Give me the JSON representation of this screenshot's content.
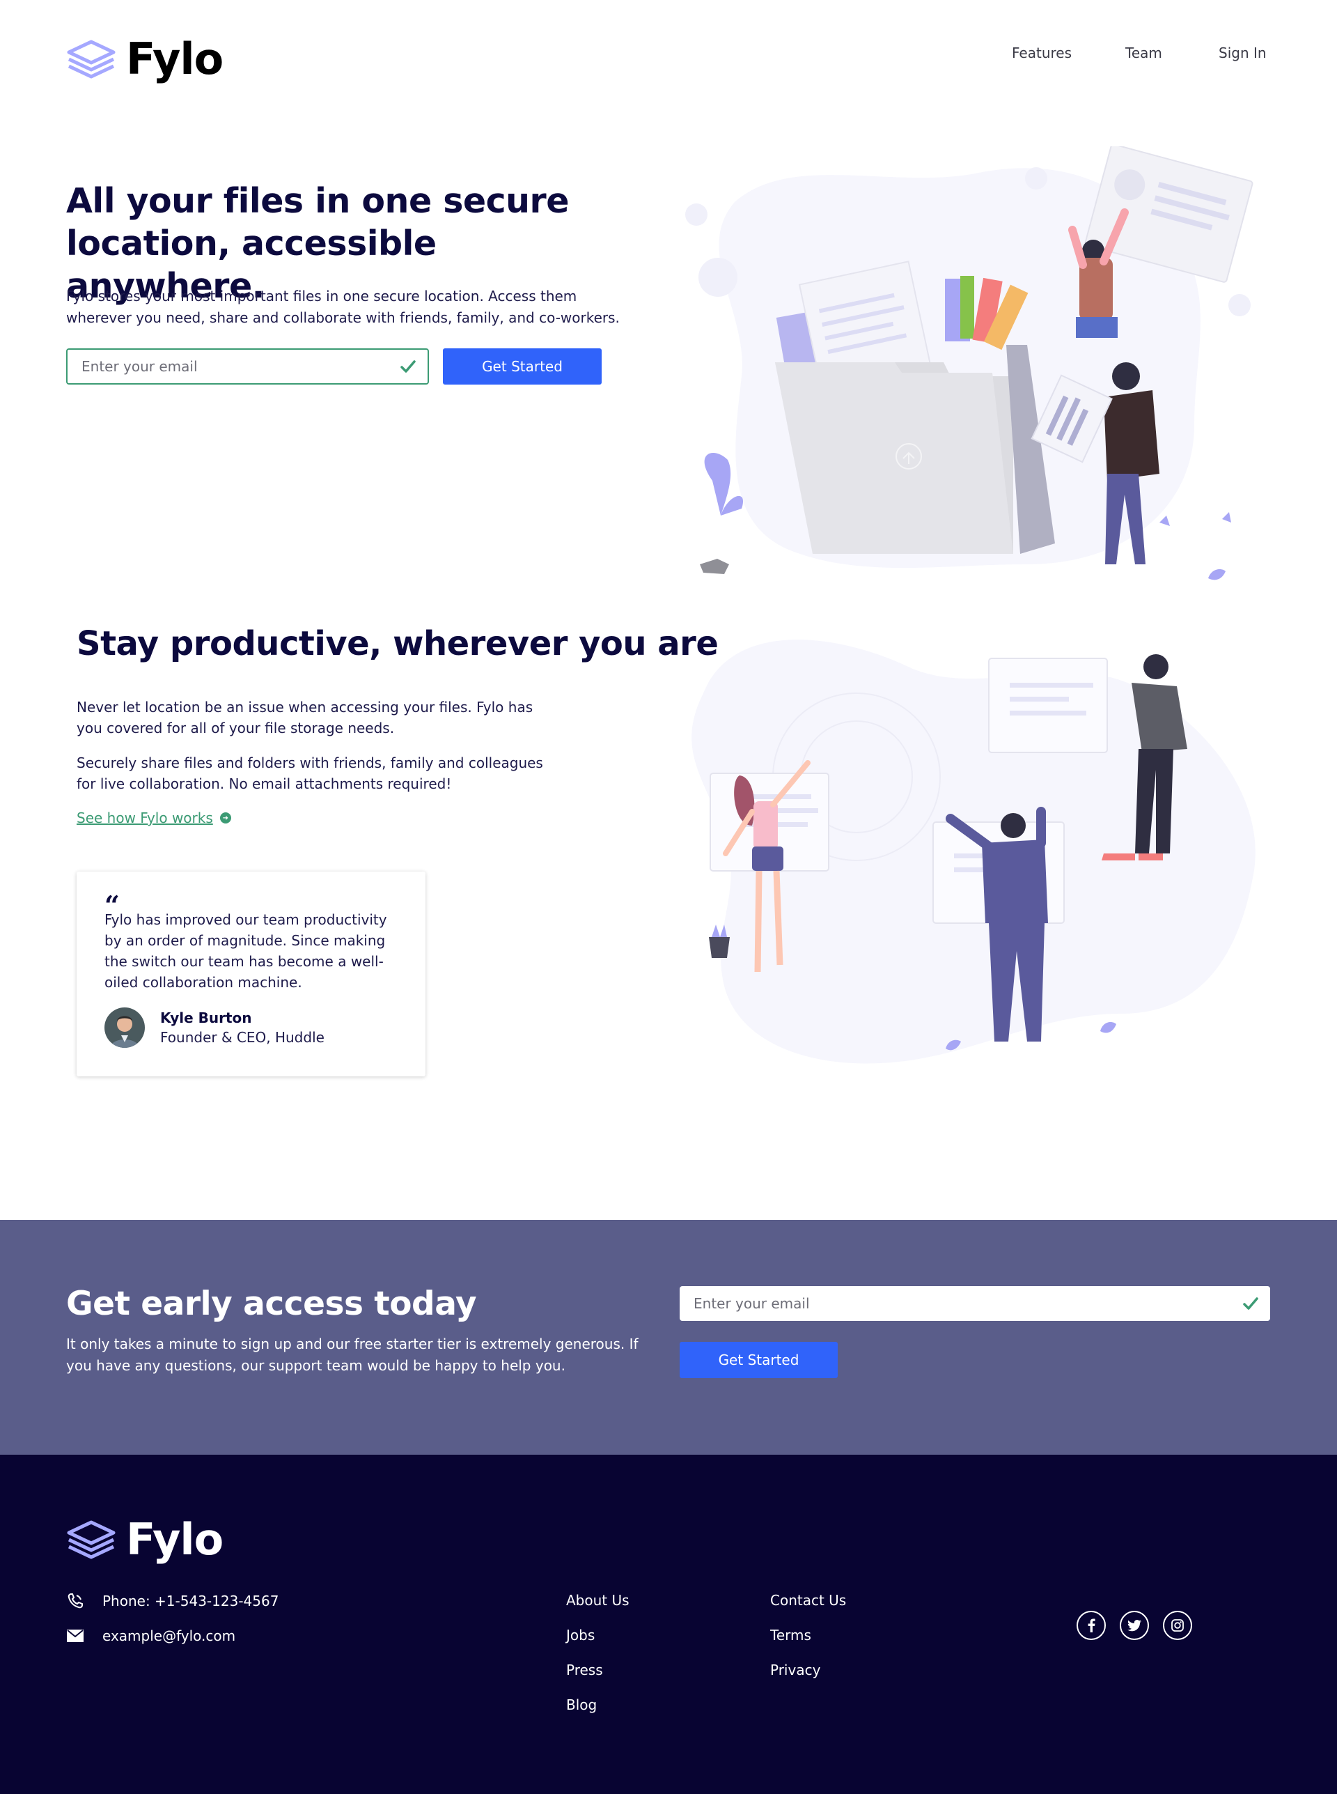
{
  "brand": {
    "name": "Fylo",
    "colors": {
      "navy": "#0c0a3e",
      "accent_blue": "#3063fa",
      "teal": "#3c9b74",
      "access_bg": "#5a5d8a",
      "footer_bg": "#080432",
      "logo_purple": "#a5a8ff"
    }
  },
  "nav": {
    "items": [
      "Features",
      "Team",
      "Sign In"
    ]
  },
  "hero": {
    "title": "All your files in one secure location, accessible anywhere.",
    "description": "Fylo stores your most important files in one secure location. Access them wherever you need, share and collaborate with friends, family, and co-workers.",
    "email_placeholder": "Enter your email",
    "cta_label": "Get Started"
  },
  "productive": {
    "title": "Stay productive, wherever you are",
    "paragraphs": [
      "Never let location be an issue when accessing your files. Fylo has you covered for all of your file storage needs.",
      "Securely share files and folders with friends, family and colleagues for live collaboration. No email attachments required!"
    ],
    "link_label": "See how Fylo works"
  },
  "testimonial": {
    "quote_mark": "“",
    "quote": "Fylo has improved our team productivity by an order of magnitude. Since making the switch our team has become a well-oiled collaboration machine.",
    "author_name": "Kyle Burton",
    "author_role": "Founder & CEO, Huddle"
  },
  "early_access": {
    "title": "Get early access today",
    "description": "It only takes a minute to sign up and our free starter tier is extremely generous. If you have any questions, our support team would be happy to help you.",
    "email_placeholder": "Enter your email",
    "cta_label": "Get Started"
  },
  "footer": {
    "phone": "Phone: +1-543-123-4567",
    "email": "example@fylo.com",
    "links_col1": [
      "About Us",
      "Jobs",
      "Press",
      "Blog"
    ],
    "links_col2": [
      "Contact Us",
      "Terms",
      "Privacy"
    ],
    "social_icons": [
      "facebook-icon",
      "twitter-icon",
      "instagram-icon"
    ]
  }
}
